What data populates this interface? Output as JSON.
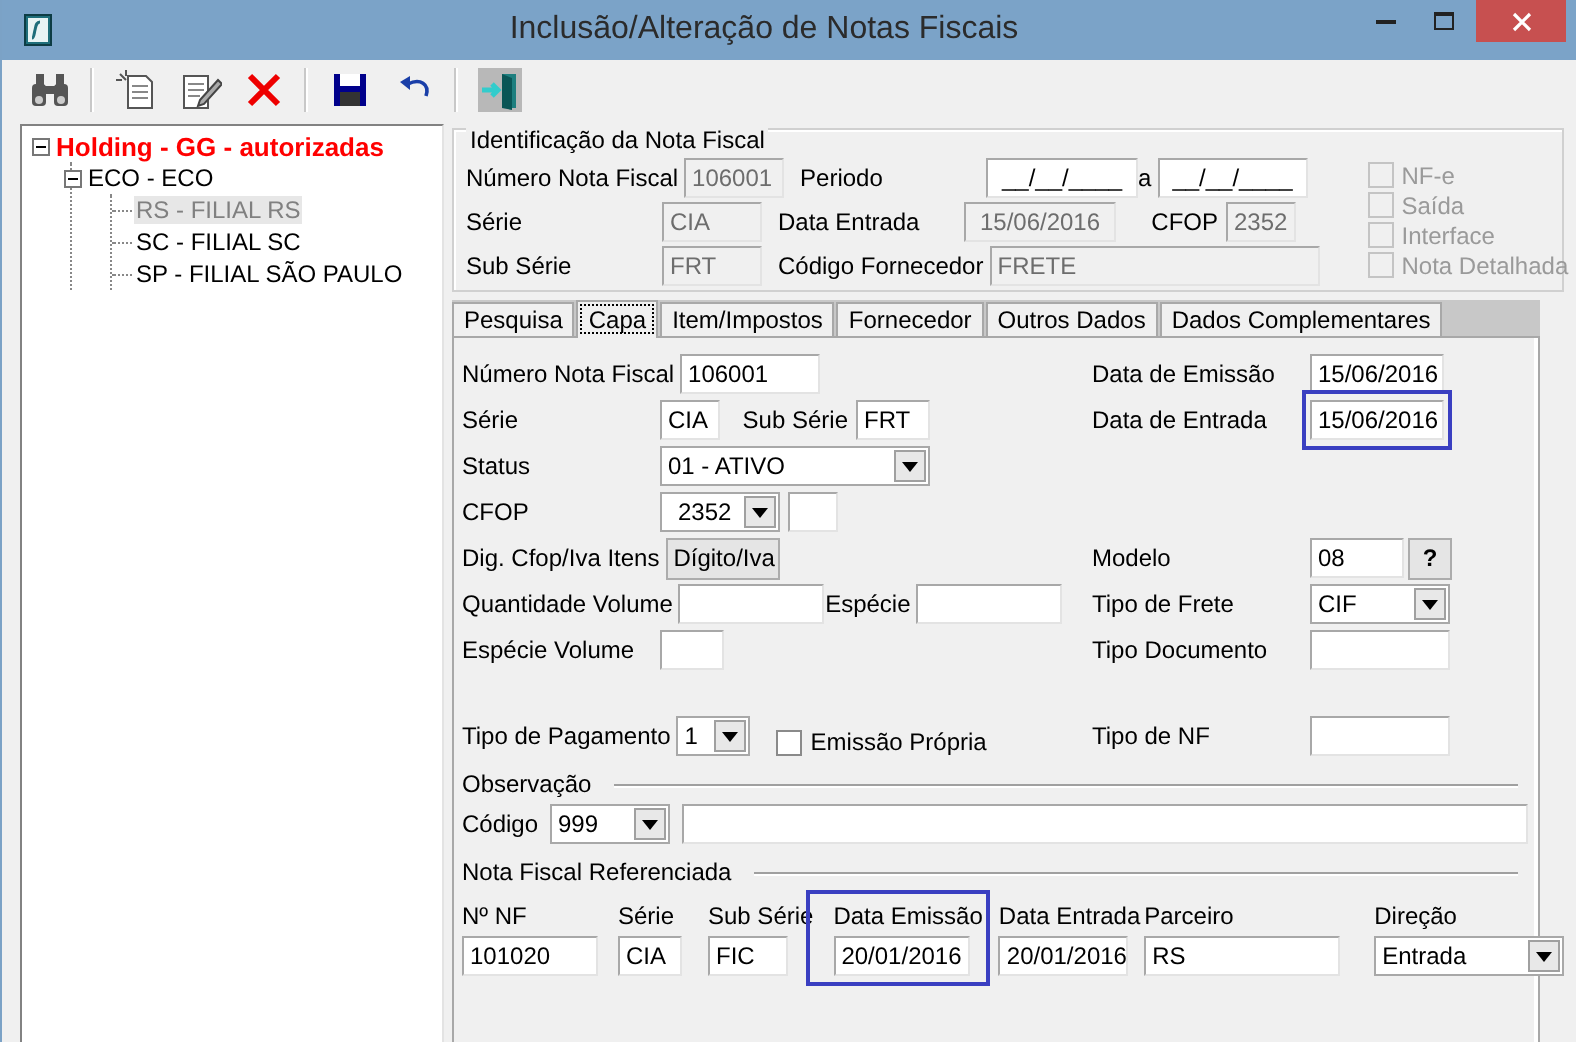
{
  "window": {
    "title": "Inclusão/Alteração de Notas Fiscais"
  },
  "tree": {
    "items": [
      {
        "label": "Holding -  GG -  autorizadas",
        "expanded": true,
        "children": [
          {
            "label": "ECO - ECO",
            "expanded": true,
            "children": [
              {
                "label": "RS - FILIAL RS",
                "selected": true
              },
              {
                "label": "SC - FILIAL SC",
                "selected": false
              },
              {
                "label": "SP - FILIAL SÃO PAULO",
                "selected": false
              }
            ]
          }
        ]
      }
    ]
  },
  "identification": {
    "title": "Identificação da Nota Fiscal",
    "numero": {
      "label": "Número Nota Fiscal",
      "value": "106001"
    },
    "serie": {
      "label": "Série",
      "value": "CIA"
    },
    "sub_serie": {
      "label": "Sub Série",
      "value": "FRT"
    },
    "periodo": {
      "label": "Periodo",
      "from": "__/__/____",
      "separator": "a",
      "to": "__/__/____"
    },
    "data_entrada": {
      "label": "Data Entrada",
      "value": "15/06/2016"
    },
    "cfop": {
      "label": "CFOP",
      "value": "2352"
    },
    "fornecedor": {
      "label": "Código Fornecedor",
      "value": "FRETE"
    },
    "options": [
      {
        "label": "NF-e",
        "checked": false,
        "disabled": true
      },
      {
        "label": "Saída",
        "checked": false,
        "disabled": true
      },
      {
        "label": "Interface",
        "checked": false,
        "disabled": true
      },
      {
        "label": "Nota Detalhada",
        "checked": false,
        "disabled": true
      }
    ]
  },
  "tabs": [
    {
      "label": "Pesquisa",
      "selected": false
    },
    {
      "label": "Capa",
      "selected": true
    },
    {
      "label": "Item/Impostos",
      "selected": false
    },
    {
      "label": "Fornecedor",
      "selected": false
    },
    {
      "label": "Outros Dados",
      "selected": false
    },
    {
      "label": "Dados Complementares",
      "selected": false
    }
  ],
  "capa": {
    "numero": {
      "label": "Número Nota Fiscal",
      "value": "106001"
    },
    "data_emissao": {
      "label": "Data de Emissão",
      "value": "15/06/2016",
      "highlighted": false
    },
    "serie": {
      "label": "Série",
      "value": "CIA"
    },
    "sub_serie": {
      "label": "Sub Série",
      "value": "FRT"
    },
    "data_entrada": {
      "label": "Data de Entrada",
      "value": "15/06/2016",
      "highlighted": true
    },
    "status": {
      "label": "Status",
      "value": "01 - ATIVO"
    },
    "cfop": {
      "label": "CFOP",
      "value": "2352"
    },
    "dig_cfop": {
      "label": "Dig. Cfop/Iva Itens",
      "button": "Dígito/Iva"
    },
    "modelo": {
      "label": "Modelo",
      "value": "08",
      "button": "?"
    },
    "quantidade_volume": {
      "label": "Quantidade Volume"
    },
    "especie": {
      "label": "Espécie"
    },
    "tipo_frete": {
      "label": "Tipo de Frete",
      "value": "CIF"
    },
    "especie_volume": {
      "label": "Espécie Volume"
    },
    "tipo_documento": {
      "label": "Tipo Documento"
    },
    "tipo_pagamento": {
      "label": "Tipo de Pagamento",
      "value": "1"
    },
    "emissao_propria": {
      "label": "Emissão Própria",
      "checked": false
    },
    "tipo_nf": {
      "label": "Tipo de NF"
    },
    "observacao": {
      "title": "Observação",
      "codigo_label": "Código",
      "codigo": "999"
    },
    "referenciada": {
      "title": "Nota Fiscal Referenciada",
      "columns": [
        {
          "kind": "text",
          "label": "Nº NF",
          "value": "101020",
          "highlighted": false
        },
        {
          "kind": "text",
          "label": "Série",
          "value": "CIA",
          "highlighted": false
        },
        {
          "kind": "text",
          "label": "Sub Série",
          "value": "FIC",
          "highlighted": false
        },
        {
          "kind": "text",
          "label": "Data Emissão",
          "value": "20/01/2016",
          "highlighted": true
        },
        {
          "kind": "text",
          "label": "Data Entrada",
          "value": "20/01/2016",
          "highlighted": false
        },
        {
          "kind": "text",
          "label": "Parceiro",
          "value": "RS",
          "highlighted": false
        },
        {
          "kind": "combo",
          "label": "Direção",
          "value": "Entrada",
          "highlighted": false
        }
      ]
    }
  }
}
